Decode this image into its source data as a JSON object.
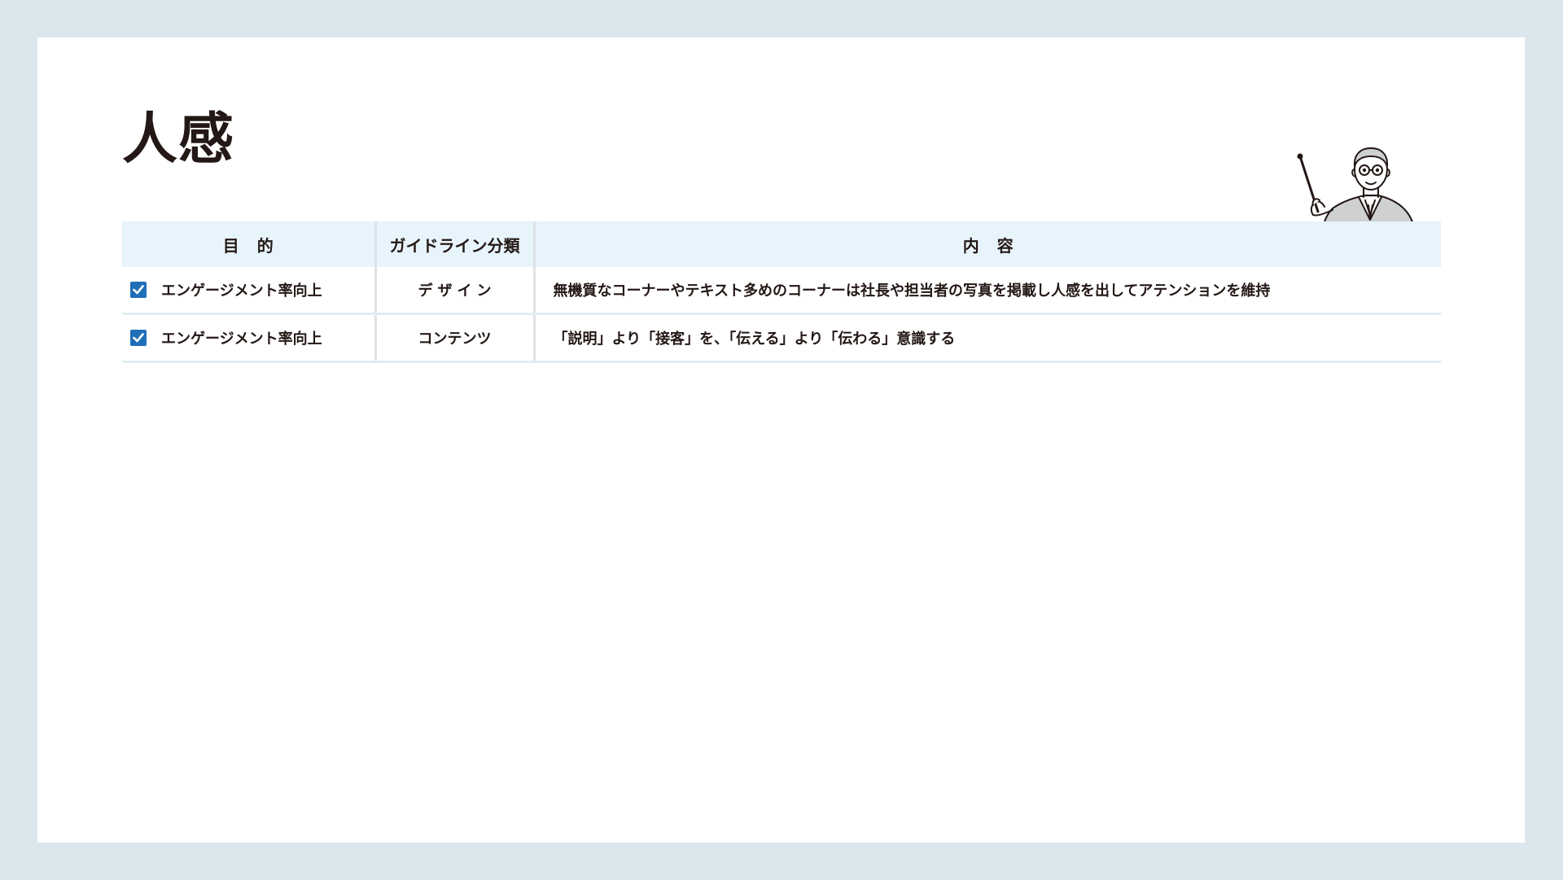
{
  "title": "人感",
  "table": {
    "headers": {
      "purpose": "目的",
      "category": "ガイドライン分類",
      "content": "内容"
    },
    "rows": [
      {
        "checked": true,
        "purpose": "エンゲージメント率向上",
        "category": "デザイン",
        "content": "無機質なコーナーやテキスト多めのコーナーは社長や担当者の写真を掲載し人感を出してアテンションを維持"
      },
      {
        "checked": true,
        "purpose": "エンゲージメント率向上",
        "category": "コンテンツ",
        "content": "「説明」より「接客」を、「伝える」より「伝わる」意識する"
      }
    ]
  },
  "icons": {
    "checkbox": "checkbox-checked-icon",
    "illustration": "presenter-with-pointer-illustration"
  },
  "colors": {
    "background": "#dce6ed",
    "header_fill": "#e8f4fb",
    "checkbox": "#1f6fb8",
    "text": "#231815"
  }
}
